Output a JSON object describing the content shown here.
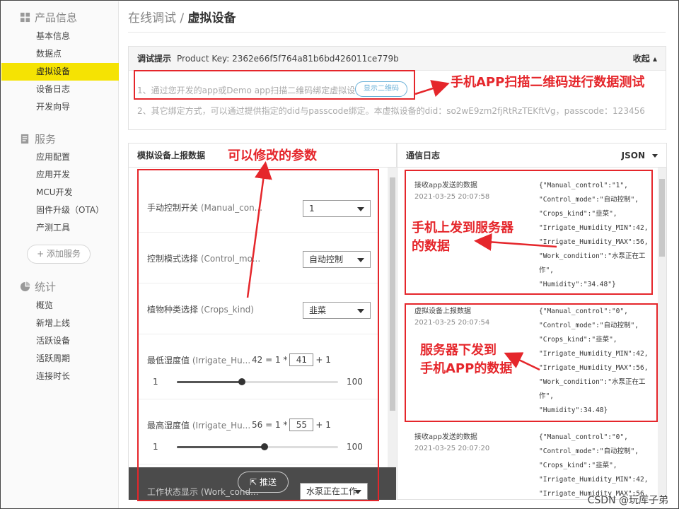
{
  "sidebar": {
    "sections": [
      {
        "title": "产品信息",
        "icon": "grid-icon"
      },
      {
        "title": "服务",
        "icon": "document-icon"
      },
      {
        "title": "统计",
        "icon": "pie-chart-icon"
      }
    ],
    "product_items": [
      "基本信息",
      "数据点",
      "虚拟设备",
      "设备日志",
      "开发向导"
    ],
    "service_items": [
      "应用配置",
      "应用开发",
      "MCU开发",
      "固件升级（OTA）",
      "产测工具"
    ],
    "add_service": "+ 添加服务",
    "stats_items": [
      "概览",
      "新增上线",
      "活跃设备",
      "活跃周期",
      "连接时长"
    ],
    "active_item": "虚拟设备"
  },
  "breadcrumb": {
    "parent": "在线调试",
    "sep": " / ",
    "current": "虚拟设备"
  },
  "tip": {
    "title": "调试提示",
    "product_key": "Product Key: 2362e66f5f764a81b6bd426011ce779b",
    "collapse": "收起",
    "line1": "1、通过您开发的app或Demo app扫描二维码绑定虚拟设备。",
    "qr_button": "显示二维码",
    "line2": "2、其它绑定方式，可以通过提供指定的did与passcode绑定。本虚拟设备的did：so2wE9zm2fjRtRzTEKftVg，passcode：123456"
  },
  "sim": {
    "title": "模拟设备上报数据",
    "fields": [
      {
        "label": "手动控制开关",
        "en": "(Manual_con...",
        "value": "1"
      },
      {
        "label": "控制模式选择",
        "en": "(Control_mo...",
        "value": "自动控制"
      },
      {
        "label": "植物种类选择",
        "en": "(Crops_kind)",
        "value": "韭菜"
      }
    ],
    "sliders": [
      {
        "label": "最低湿度值",
        "en": "(Irrigate_Hu...",
        "formula_left": "42 = 1 *",
        "box": "41",
        "formula_right": "+ 1",
        "min": "1",
        "max": "100",
        "value": 41
      },
      {
        "label": "最高湿度值",
        "en": "(Irrigate_Hu...",
        "formula_left": "56 = 1 *",
        "box": "55",
        "formula_right": "+ 1",
        "min": "1",
        "max": "100",
        "value": 55
      }
    ],
    "partial_field": {
      "label": "工作状态显示",
      "en": "(Work_cond...",
      "value": "水泵正在工作"
    },
    "push": "推送"
  },
  "log": {
    "title": "通信日志",
    "format": "JSON",
    "entries": [
      {
        "type": "接收app发送的数据",
        "time": "2021-03-25 20:07:58",
        "json": [
          "{\"Manual_control\":\"1\",",
          "\"Control_mode\":\"自动控制\",",
          "\"Crops_kind\":\"韭菜\",",
          "\"Irrigate_Humidity_MIN\":42,",
          "\"Irrigate_Humidity_MAX\":56,",
          "\"Work_condition\":\"水泵正在工",
          "作\",",
          "\"Humidity\":\"34.48\"}"
        ]
      },
      {
        "type": "虚拟设备上报数据",
        "time": "2021-03-25 20:07:54",
        "json": [
          "{\"Manual_control\":\"0\",",
          "\"Control_mode\":\"自动控制\",",
          "\"Crops_kind\":\"韭菜\",",
          "\"Irrigate_Humidity_MIN\":42,",
          "\"Irrigate_Humidity_MAX\":56,",
          "\"Work_condition\":\"水泵正在工",
          "作\",",
          "\"Humidity\":34.48}"
        ]
      },
      {
        "type": "接收app发送的数据",
        "time": "2021-03-25 20:07:20",
        "json": [
          "{\"Manual_control\":\"0\",",
          "\"Control_mode\":\"自动控制\",",
          "\"Crops_kind\":\"韭菜\",",
          "\"Irrigate_Humidity_MIN\":42,",
          "\"Irrigate_Humidity_MAX\":56,"
        ]
      }
    ]
  },
  "annotations": {
    "qr": "手机APP扫描二维码进行数据测试",
    "params": "可以修改的参数",
    "up_line1": "手机上发到服务器",
    "up_line2": "的数据",
    "down_line1": "服务器下发到",
    "down_line2": "手机APP的数据"
  },
  "watermark": "CSDN @玩库子弟",
  "colors": {
    "active_bg": "#f5e303",
    "annotation": "#e5262b",
    "push_bar": "#4b4b4b"
  }
}
